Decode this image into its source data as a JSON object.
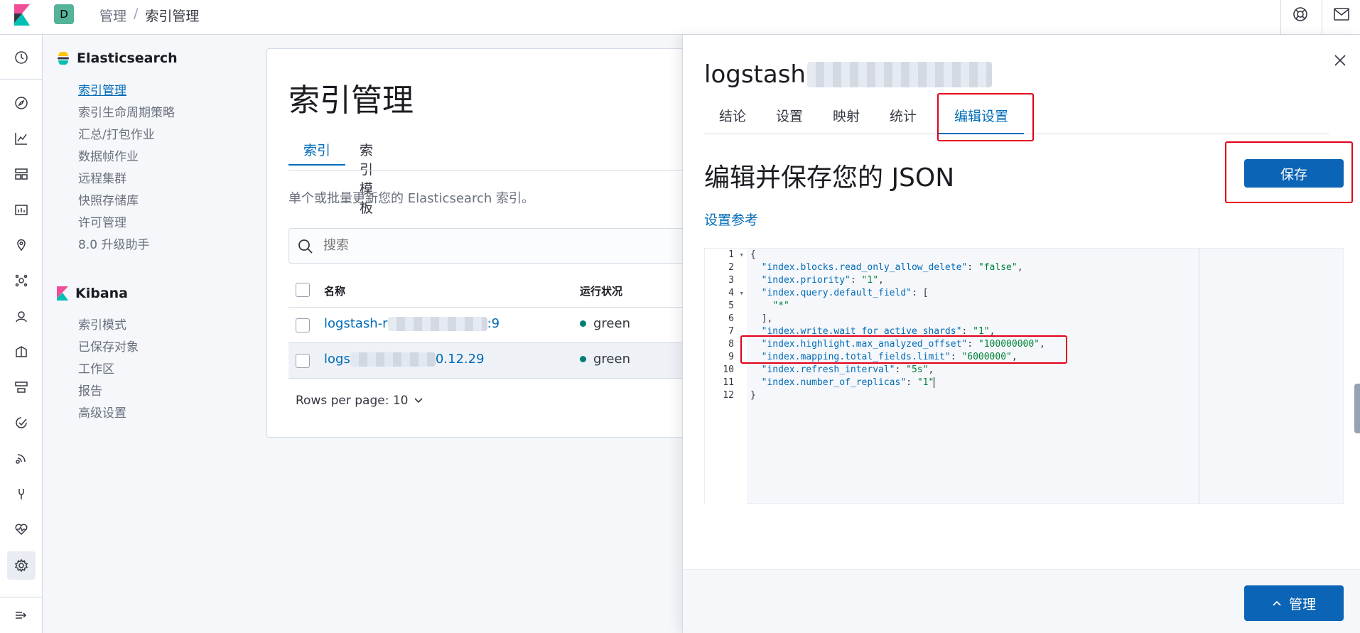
{
  "header": {
    "space_initial": "D",
    "breadcrumbs": [
      "管理",
      "索引管理"
    ],
    "breadcrumb_separator": "/",
    "icons": [
      "help-icon",
      "mail-icon"
    ]
  },
  "rail": {
    "icons": [
      "clock-icon",
      "compass-icon",
      "visualize-icon",
      "dashboard-icon",
      "canvas-icon",
      "maps-icon",
      "ml-icon",
      "graph-icon",
      "logs-icon",
      "infrastructure-icon",
      "uptime-icon",
      "apm-icon",
      "dev-tools-icon",
      "monitoring-icon",
      "gear-icon",
      "collapse-icon"
    ]
  },
  "sidenav": {
    "elasticsearch": {
      "title": "Elasticsearch",
      "items": [
        "索引管理",
        "索引生命周期策略",
        "汇总/打包作业",
        "数据帧作业",
        "远程集群",
        "快照存储库",
        "许可管理",
        "8.0 升级助手"
      ]
    },
    "kibana": {
      "title": "Kibana",
      "items": [
        "索引模式",
        "已保存对象",
        "工作区",
        "报告",
        "高级设置"
      ]
    }
  },
  "main": {
    "title": "索引管理",
    "tabs": [
      "索引",
      "索引模板"
    ],
    "description": "单个或批量更新您的 Elasticsearch 索引。",
    "search_placeholder": "搜索",
    "columns": [
      "名称",
      "运行状况"
    ],
    "rows": [
      {
        "name_prefix": "logstash-r",
        "name_suffix": ":9",
        "health": "green"
      },
      {
        "name_prefix": "logs",
        "name_suffix": "0.12.29",
        "health": "green"
      }
    ],
    "rows_per_page": "Rows per page: 10"
  },
  "flyout": {
    "title": "logstash",
    "tabs": [
      "结论",
      "设置",
      "映射",
      "统计",
      "编辑设置"
    ],
    "active_tab": "编辑设置",
    "heading": "编辑并保存您的 JSON",
    "save_label": "保存",
    "settings_reference": "设置参考",
    "footer_button": "管理",
    "highlight_color": "#e3001b",
    "accent_color": "#006bb8",
    "code_lines": [
      {
        "n": "1",
        "fold": true,
        "parts": [
          {
            "t": "{",
            "c": ""
          }
        ]
      },
      {
        "n": "2",
        "fold": false,
        "parts": [
          {
            "t": "  ",
            "c": ""
          },
          {
            "t": "\"index.blocks.read_only_allow_delete\"",
            "c": "k"
          },
          {
            "t": ": ",
            "c": ""
          },
          {
            "t": "\"false\"",
            "c": "v"
          },
          {
            "t": ",",
            "c": ""
          }
        ]
      },
      {
        "n": "3",
        "fold": false,
        "parts": [
          {
            "t": "  ",
            "c": ""
          },
          {
            "t": "\"index.priority\"",
            "c": "k"
          },
          {
            "t": ": ",
            "c": ""
          },
          {
            "t": "\"1\"",
            "c": "v"
          },
          {
            "t": ",",
            "c": ""
          }
        ]
      },
      {
        "n": "4",
        "fold": true,
        "parts": [
          {
            "t": "  ",
            "c": ""
          },
          {
            "t": "\"index.query.default_field\"",
            "c": "k"
          },
          {
            "t": ": [",
            "c": ""
          }
        ]
      },
      {
        "n": "5",
        "fold": false,
        "parts": [
          {
            "t": "    ",
            "c": ""
          },
          {
            "t": "\"*\"",
            "c": "v"
          }
        ]
      },
      {
        "n": "6",
        "fold": false,
        "parts": [
          {
            "t": "  ],",
            "c": ""
          }
        ]
      },
      {
        "n": "7",
        "fold": false,
        "parts": [
          {
            "t": "  ",
            "c": ""
          },
          {
            "t": "\"index.write.wait_for_active_shards\"",
            "c": "k"
          },
          {
            "t": ": ",
            "c": ""
          },
          {
            "t": "\"1\"",
            "c": "v"
          },
          {
            "t": ",",
            "c": ""
          }
        ]
      },
      {
        "n": "8",
        "fold": false,
        "parts": [
          {
            "t": "  ",
            "c": ""
          },
          {
            "t": "\"index.highlight.max_analyzed_offset\"",
            "c": "k"
          },
          {
            "t": ": ",
            "c": ""
          },
          {
            "t": "\"100000000\"",
            "c": "v"
          },
          {
            "t": ",",
            "c": ""
          }
        ]
      },
      {
        "n": "9",
        "fold": false,
        "parts": [
          {
            "t": "  ",
            "c": ""
          },
          {
            "t": "\"index.mapping.total_fields.limit\"",
            "c": "k"
          },
          {
            "t": ": ",
            "c": ""
          },
          {
            "t": "\"6000000\"",
            "c": "v"
          },
          {
            "t": ",",
            "c": ""
          }
        ]
      },
      {
        "n": "10",
        "fold": false,
        "parts": [
          {
            "t": "  ",
            "c": ""
          },
          {
            "t": "\"index.refresh_interval\"",
            "c": "k"
          },
          {
            "t": ": ",
            "c": ""
          },
          {
            "t": "\"5s\"",
            "c": "v"
          },
          {
            "t": ",",
            "c": ""
          }
        ]
      },
      {
        "n": "11",
        "fold": false,
        "parts": [
          {
            "t": "  ",
            "c": ""
          },
          {
            "t": "\"index.number_of_replicas\"",
            "c": "k"
          },
          {
            "t": ": ",
            "c": ""
          },
          {
            "t": "\"1\"",
            "c": "v"
          }
        ]
      },
      {
        "n": "12",
        "fold": false,
        "parts": [
          {
            "t": "}",
            "c": ""
          }
        ]
      }
    ]
  }
}
